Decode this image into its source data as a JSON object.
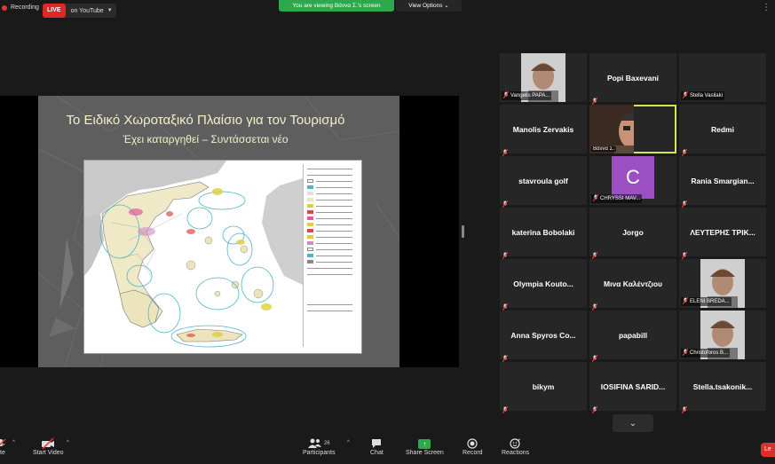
{
  "topbar": {
    "recording_label": "Recording",
    "live_badge": "LIVE",
    "live_target": "on YouTube",
    "viewing_banner": "You are viewing Βάννα Σ.'s screen",
    "view_options": "View Options"
  },
  "slide": {
    "title": "Το Ειδικό Χωροταξικό Πλαίσιο για τον Τουρισμό",
    "subtitle": "Έχει καταργηθεί – Συντάσσεται νέο"
  },
  "participants": [
    {
      "name": "Vangelis PAPA...",
      "type": "photo",
      "label": true
    },
    {
      "name": "Popi Baxevani",
      "type": "name"
    },
    {
      "name": "Stella Vasilaki",
      "type": "label-only",
      "label": true
    },
    {
      "name": "Manolis Zervakis",
      "type": "name"
    },
    {
      "name": "Βάννα Σ.",
      "type": "video",
      "label": true,
      "active": true
    },
    {
      "name": "Redmi",
      "type": "name"
    },
    {
      "name": "stavroula golf",
      "type": "name"
    },
    {
      "name": "CHRYSSI MAV...",
      "type": "avatar",
      "initial": "C",
      "label": true
    },
    {
      "name": "Rania  Smargian...",
      "type": "name"
    },
    {
      "name": "katerina Bobolaki",
      "type": "name"
    },
    {
      "name": "Jorgo",
      "type": "name"
    },
    {
      "name": "ΛΕΥΤΕΡΗΣ  ΤΡΙΚ...",
      "type": "name"
    },
    {
      "name": "Olympia  Kouto...",
      "type": "name"
    },
    {
      "name": "Μινα Καλέντζιου",
      "type": "name"
    },
    {
      "name": "ELENI BREDA...",
      "type": "photo",
      "label": true
    },
    {
      "name": "Anna Spyros Co...",
      "type": "name"
    },
    {
      "name": "papabill",
      "type": "name"
    },
    {
      "name": "Christoforos B...",
      "type": "photo",
      "label": true
    },
    {
      "name": "bikym",
      "type": "name"
    },
    {
      "name": "IOSIFINA  SARID...",
      "type": "name"
    },
    {
      "name": "Stella.tsakonik...",
      "type": "name"
    }
  ],
  "toolbar": {
    "mute": "ute",
    "start_video": "Start Video",
    "participants": "Participants",
    "participants_count": "26",
    "chat": "Chat",
    "share_screen": "Share Screen",
    "record": "Record",
    "reactions": "Reactions",
    "leave": "Le"
  },
  "colors": {
    "accent_green": "#2ea84c",
    "live_red": "#e02828",
    "active_speaker": "#d6e64b",
    "avatar_purple": "#9b4fc3"
  }
}
